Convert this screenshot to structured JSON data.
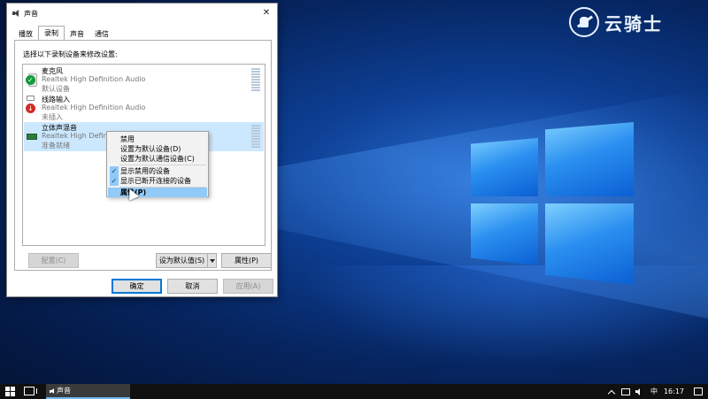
{
  "watermark": {
    "text": "云骑士"
  },
  "dialog": {
    "title": "声音",
    "tabs": [
      {
        "label": "播放"
      },
      {
        "label": "录制",
        "active": true
      },
      {
        "label": "声音"
      },
      {
        "label": "通信"
      }
    ],
    "instruction": "选择以下录制设备来修改设置:",
    "devices": [
      {
        "name": "麦克风",
        "driver": "Realtek High Definition Audio",
        "status": "默认设备",
        "icon": "microphone-icon",
        "badge": "default-check"
      },
      {
        "name": "线路输入",
        "driver": "Realtek High Definition Audio",
        "status": "未插入",
        "icon": "line-in-icon",
        "badge": "unplugged-down-arrow"
      },
      {
        "name": "立体声混音",
        "driver": "Realtek High Definition Audio",
        "status": "准备就绪",
        "icon": "stereo-mix-icon",
        "selected": true
      }
    ],
    "configure_label": "配置(C)",
    "set_default_label": "设为默认值(S)",
    "properties_label": "属性(P)",
    "ok_label": "确定",
    "cancel_label": "取消",
    "apply_label": "应用(A)"
  },
  "context_menu": {
    "items": [
      {
        "label": "禁用"
      },
      {
        "label": "设置为默认设备(D)"
      },
      {
        "label": "设置为默认通信设备(C)"
      },
      {
        "label": "显示禁用的设备",
        "checked": true
      },
      {
        "label": "显示已断开连接的设备",
        "checked": true
      },
      {
        "label": "属性(P)",
        "highlighted": true
      }
    ]
  },
  "taskbar": {
    "app_label": "声音",
    "ime": "中",
    "clock": "16:17"
  }
}
